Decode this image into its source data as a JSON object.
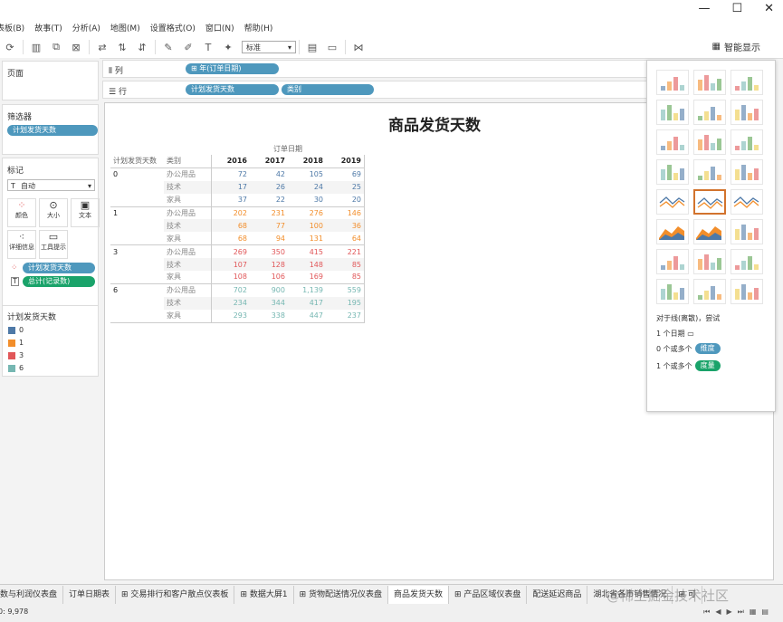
{
  "menu": [
    "表板(B)",
    "故事(T)",
    "分析(A)",
    "地图(M)",
    "设置格式(O)",
    "窗口(N)",
    "帮助(H)"
  ],
  "toolbar": {
    "fit_select": "标准",
    "smart_label": "智能显示"
  },
  "left": {
    "pages_title": "页面",
    "filters_title": "筛选器",
    "filter_pill": "计划发货天数",
    "marks_title": "标记",
    "marks_type": "自动",
    "mark_buttons": [
      "颜色",
      "大小",
      "文本",
      "详细信息",
      "工具提示"
    ],
    "mark_pills": [
      "计划发货天数",
      "总计(记录数)"
    ],
    "legend_title": "计划发货天数",
    "legend": [
      {
        "label": "0",
        "color": "#4e79a7"
      },
      {
        "label": "1",
        "color": "#f28e2b"
      },
      {
        "label": "3",
        "color": "#e15759"
      },
      {
        "label": "6",
        "color": "#76b7b2"
      }
    ]
  },
  "shelves": {
    "columns_label": "列",
    "columns_pills": [
      "⊞ 年(订单日期)"
    ],
    "rows_label": "行",
    "rows_pills": [
      "计划发货天数",
      "类别"
    ]
  },
  "view": {
    "title": "商品发货天数",
    "col_header": "订单日期",
    "row_headers": [
      "计划发货天数",
      "类别"
    ],
    "years": [
      "2016",
      "2017",
      "2018",
      "2019"
    ],
    "groups": [
      {
        "key": "0",
        "color": "#4e79a7",
        "rows": [
          {
            "cat": "办公用品",
            "vals": [
              "72",
              "42",
              "105",
              "69"
            ]
          },
          {
            "cat": "技术",
            "vals": [
              "17",
              "26",
              "24",
              "25"
            ]
          },
          {
            "cat": "家具",
            "vals": [
              "37",
              "22",
              "30",
              "20"
            ]
          }
        ]
      },
      {
        "key": "1",
        "color": "#f28e2b",
        "rows": [
          {
            "cat": "办公用品",
            "vals": [
              "202",
              "231",
              "276",
              "146"
            ]
          },
          {
            "cat": "技术",
            "vals": [
              "68",
              "77",
              "100",
              "36"
            ]
          },
          {
            "cat": "家具",
            "vals": [
              "68",
              "94",
              "131",
              "64"
            ]
          }
        ]
      },
      {
        "key": "3",
        "color": "#e15759",
        "rows": [
          {
            "cat": "办公用品",
            "vals": [
              "269",
              "350",
              "415",
              "221"
            ]
          },
          {
            "cat": "技术",
            "vals": [
              "107",
              "128",
              "148",
              "85"
            ]
          },
          {
            "cat": "家具",
            "vals": [
              "108",
              "106",
              "169",
              "85"
            ]
          }
        ]
      },
      {
        "key": "6",
        "color": "#76b7b2",
        "rows": [
          {
            "cat": "办公用品",
            "vals": [
              "702",
              "900",
              "1,139",
              "559"
            ]
          },
          {
            "cat": "技术",
            "vals": [
              "234",
              "344",
              "417",
              "195"
            ]
          },
          {
            "cat": "家具",
            "vals": [
              "293",
              "338",
              "447",
              "237"
            ]
          }
        ]
      }
    ]
  },
  "showme": {
    "hint": "对于线(离散)，尝试",
    "req": [
      {
        "text": "1 个日期",
        "pill": ""
      },
      {
        "text": "0 个或多个",
        "pill": "维度"
      },
      {
        "text": "1 个或多个",
        "pill": "度量"
      }
    ]
  },
  "tabs": [
    "数与利润仪表盘",
    "订单日期表",
    "⊞ 交易排行和客户散点仪表板",
    "⊞ 数据大屏1",
    "⊞ 货物配送情况仪表盘",
    "商品发货天数",
    "⊞ 产品区域仪表盘",
    "配送延迟商品",
    "湖北省各市销售情况",
    "⊞ 可"
  ],
  "active_tab": "商品发货天数",
  "status": {
    "count": "0: 9,978"
  },
  "watermark": "@稀土掘金技术社区"
}
